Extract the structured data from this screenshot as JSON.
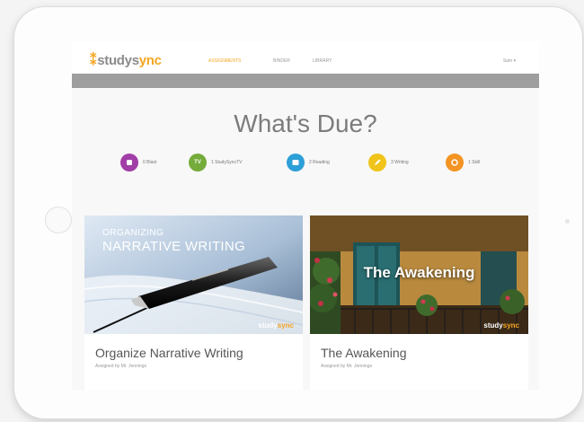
{
  "header": {
    "logo_prefix": "studys",
    "logo_accent": "ync",
    "nav": [
      "ASSIGNMENTS",
      "BINDER",
      "LIBRARY"
    ],
    "user_menu": "Sam ▾"
  },
  "main": {
    "title": "What's Due?"
  },
  "filters": [
    {
      "label": "0 Blast",
      "color": "#a23ea7",
      "icon": "blast-icon"
    },
    {
      "label": "1 StudySyncTV",
      "color": "#74ab3a",
      "icon": "tv-icon"
    },
    {
      "label": "2 Reading",
      "color": "#2d9fd8",
      "icon": "book-icon"
    },
    {
      "label": "3 Writing",
      "color": "#f0c419",
      "icon": "pencil-icon"
    },
    {
      "label": "1 Skill",
      "color": "#f39423",
      "icon": "skill-icon"
    }
  ],
  "cards": [
    {
      "image_heading_1": "ORGANIZING",
      "image_heading_2": "NARRATIVE WRITING",
      "image_brand_prefix": "study",
      "image_brand_accent": "sync",
      "title": "Organize Narrative Writing",
      "subtitle": "Assigned by Mr. Jennings"
    },
    {
      "image_heading": "The Awakening",
      "image_brand_prefix": "study",
      "image_brand_accent": "sync",
      "title": "The Awakening",
      "subtitle": "Assigned by Mr. Jennings"
    }
  ]
}
